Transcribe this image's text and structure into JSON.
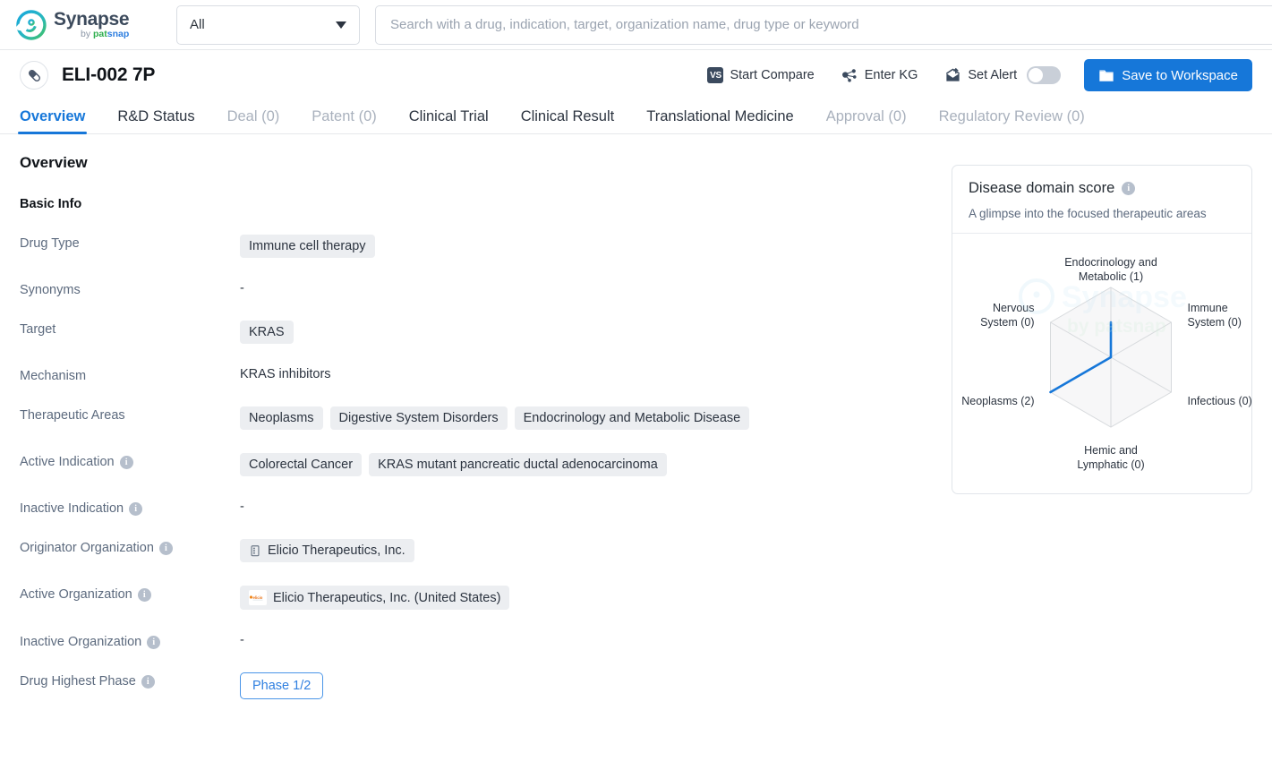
{
  "brand": {
    "name": "Synapse",
    "by": "by",
    "pat": "pat",
    "snap": "snap",
    "logo_icon": "synapse-logo-icon"
  },
  "search": {
    "scope_value": "All",
    "scope_icon": "chevron-down-icon",
    "placeholder": "Search with a drug, indication, target, organization name, drug type or keyword",
    "value": ""
  },
  "drug_header": {
    "icon": "capsule-icon",
    "title": "ELI-002 7P",
    "actions": [
      {
        "label": "Start Compare",
        "icon": "vs-icon",
        "icon_text": "VS"
      },
      {
        "label": "Enter KG",
        "icon": "knowledge-graph-icon"
      },
      {
        "label": "Set Alert",
        "icon": "alert-bell-icon"
      }
    ],
    "alert_toggle_on": false,
    "save_label": "Save to Workspace",
    "save_icon": "folder-icon",
    "save_color": "#1677d9"
  },
  "tabs": [
    {
      "label": "Overview",
      "state": "active"
    },
    {
      "label": "R&D Status",
      "state": "normal"
    },
    {
      "label": "Deal (0)",
      "state": "disabled"
    },
    {
      "label": "Patent (0)",
      "state": "disabled"
    },
    {
      "label": "Clinical Trial",
      "state": "normal"
    },
    {
      "label": "Clinical Result",
      "state": "normal"
    },
    {
      "label": "Translational Medicine",
      "state": "normal"
    },
    {
      "label": "Approval (0)",
      "state": "disabled"
    },
    {
      "label": "Regulatory Review (0)",
      "state": "disabled"
    }
  ],
  "overview": {
    "heading": "Overview",
    "basic_info_heading": "Basic Info",
    "rows": {
      "drug_type": {
        "label": "Drug Type",
        "chips": [
          "Immune cell therapy"
        ]
      },
      "synonyms": {
        "label": "Synonyms",
        "text": "-"
      },
      "target": {
        "label": "Target",
        "chips": [
          "KRAS"
        ]
      },
      "mechanism": {
        "label": "Mechanism",
        "text": "KRAS inhibitors"
      },
      "therapeutic_areas": {
        "label": "Therapeutic Areas",
        "chips": [
          "Neoplasms",
          "Digestive System Disorders",
          "Endocrinology and Metabolic Disease"
        ]
      },
      "active_indication": {
        "label": "Active Indication",
        "has_info": true,
        "chips": [
          "Colorectal Cancer",
          "KRAS mutant pancreatic ductal adenocarcinoma"
        ]
      },
      "inactive_indication": {
        "label": "Inactive Indication",
        "has_info": true,
        "text": "-"
      },
      "originator_organization": {
        "label": "Originator Organization",
        "has_info": true,
        "org": "Elicio Therapeutics, Inc.",
        "org_icon": "building-icon"
      },
      "active_organization": {
        "label": "Active Organization",
        "has_info": true,
        "org": "Elicio Therapeutics, Inc. (United States)",
        "org_icon": "elicio-logo-icon"
      },
      "inactive_organization": {
        "label": "Inactive Organization",
        "has_info": true,
        "text": "-"
      },
      "drug_highest_phase": {
        "label": "Drug Highest Phase",
        "has_info": true,
        "phase": "Phase 1/2"
      }
    }
  },
  "score_card": {
    "title": "Disease domain score",
    "info_icon": "info-icon",
    "subtitle": "A glimpse into the focused therapeutic areas"
  },
  "chart_data": {
    "type": "radar",
    "title": "Disease domain score",
    "subtitle": "A glimpse into the focused therapeutic areas",
    "categories": [
      "Endocrinology and Metabolic (1)",
      "Immune System (0)",
      "Infectious (0)",
      "Hemic and Lymphatic (0)",
      "Neoplasms (2)",
      "Nervous System (0)"
    ],
    "axis_labels": [
      [
        "Endocrinology and",
        "Metabolic (1)"
      ],
      [
        "Immune",
        "System (0)"
      ],
      [
        "Infectious (0)"
      ],
      [
        "Hemic and",
        "Lymphatic (0)"
      ],
      [
        "Neoplasms (2)"
      ],
      [
        "Nervous",
        "System (0)"
      ]
    ],
    "values": [
      1,
      0,
      0,
      0,
      2,
      0
    ],
    "max": 2,
    "rings": 3,
    "line_color": "#1677d9",
    "grid_color": "#d7dadd",
    "legend": "none"
  },
  "watermark": {
    "text_1": "Synapse",
    "text_2": "by patsnap"
  }
}
